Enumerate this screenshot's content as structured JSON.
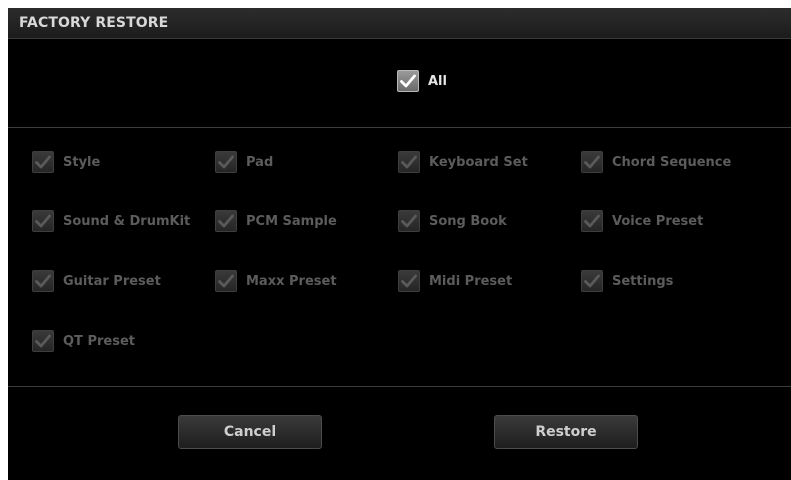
{
  "dialog": {
    "title": "FACTORY RESTORE",
    "all": {
      "label": "All",
      "checked": true
    },
    "items": [
      {
        "label": "Style",
        "checked": true
      },
      {
        "label": "Pad",
        "checked": true
      },
      {
        "label": "Keyboard Set",
        "checked": true
      },
      {
        "label": "Chord Sequence",
        "checked": true
      },
      {
        "label": "Sound & DrumKit",
        "checked": true
      },
      {
        "label": "PCM Sample",
        "checked": true
      },
      {
        "label": "Song Book",
        "checked": true
      },
      {
        "label": "Voice Preset",
        "checked": true
      },
      {
        "label": "Guitar Preset",
        "checked": true
      },
      {
        "label": "Maxx Preset",
        "checked": true
      },
      {
        "label": "Midi Preset",
        "checked": true
      },
      {
        "label": "Settings",
        "checked": true
      },
      {
        "label": "QT Preset",
        "checked": true
      }
    ],
    "buttons": {
      "cancel": "Cancel",
      "restore": "Restore"
    },
    "icons": {
      "check": "checkmark-icon"
    },
    "colors": {
      "background": "#000000",
      "active_check": "#ffffff",
      "disabled_check": "#5a5a5a"
    }
  }
}
